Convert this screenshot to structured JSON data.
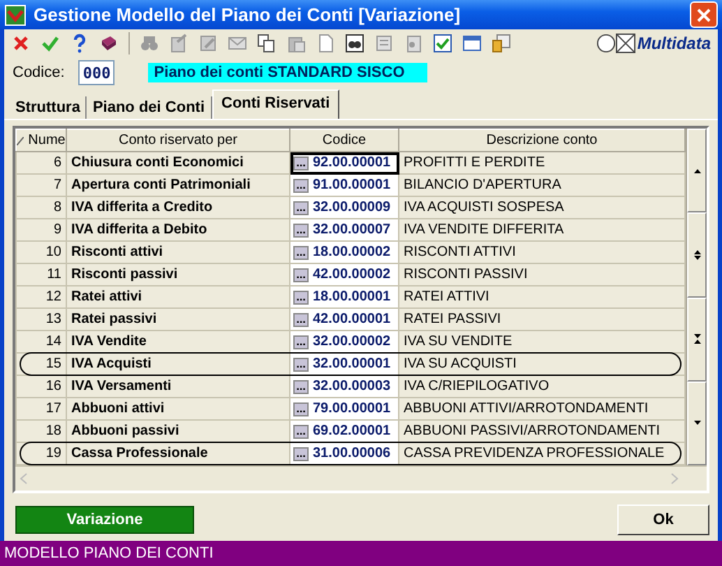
{
  "window": {
    "title": "Gestione Modello del Piano dei Conti [Variazione]"
  },
  "brand": "Multidata",
  "codice": {
    "label": "Codice:",
    "value": "000",
    "description": "Piano dei conti STANDARD SISCO"
  },
  "tabs": [
    {
      "label": "Struttura",
      "selected": false
    },
    {
      "label": "Piano dei Conti",
      "selected": false
    },
    {
      "label": "Conti Riservati",
      "selected": true
    }
  ],
  "table": {
    "columns": [
      "Nume",
      "Conto riservato per",
      "Codice",
      "Descrizione conto"
    ],
    "rows": [
      {
        "num": "6",
        "conto": "Chiusura conti Economici",
        "codice": "92.00.00001",
        "descrizione": "PROFITTI E PERDITE",
        "selected": true
      },
      {
        "num": "7",
        "conto": "Apertura conti Patrimoniali",
        "codice": "91.00.00001",
        "descrizione": "BILANCIO D'APERTURA",
        "selected": false
      },
      {
        "num": "8",
        "conto": "IVA differita a Credito",
        "codice": "32.00.00009",
        "descrizione": "IVA ACQUISTI SOSPESA",
        "selected": false
      },
      {
        "num": "9",
        "conto": "IVA differita a Debito",
        "codice": "32.00.00007",
        "descrizione": "IVA VENDITE DIFFERITA",
        "selected": false
      },
      {
        "num": "10",
        "conto": "Risconti attivi",
        "codice": "18.00.00002",
        "descrizione": "RISCONTI ATTIVI",
        "selected": false
      },
      {
        "num": "11",
        "conto": "Risconti passivi",
        "codice": "42.00.00002",
        "descrizione": "RISCONTI PASSIVI",
        "selected": false
      },
      {
        "num": "12",
        "conto": "Ratei attivi",
        "codice": "18.00.00001",
        "descrizione": "RATEI ATTIVI",
        "selected": false
      },
      {
        "num": "13",
        "conto": "Ratei passivi",
        "codice": "42.00.00001",
        "descrizione": "RATEI PASSIVI",
        "selected": false
      },
      {
        "num": "14",
        "conto": "IVA Vendite",
        "codice": "32.00.00002",
        "descrizione": "IVA SU VENDITE",
        "selected": false,
        "circled": false
      },
      {
        "num": "15",
        "conto": "IVA Acquisti",
        "codice": "32.00.00001",
        "descrizione": "IVA SU ACQUISTI",
        "selected": false,
        "circled": true
      },
      {
        "num": "16",
        "conto": "IVA Versamenti",
        "codice": "32.00.00003",
        "descrizione": "IVA C/RIEPILOGATIVO",
        "selected": false,
        "circled": false
      },
      {
        "num": "17",
        "conto": "Abbuoni attivi",
        "codice": "79.00.00001",
        "descrizione": "ABBUONI ATTIVI/ARROTONDAMENTI",
        "selected": false
      },
      {
        "num": "18",
        "conto": "Abbuoni passivi",
        "codice": "69.02.00001",
        "descrizione": "ABBUONI PASSIVI/ARROTONDAMENTI",
        "selected": false
      },
      {
        "num": "19",
        "conto": "Cassa Professionale",
        "codice": "31.00.00006",
        "descrizione": "CASSA PREVIDENZA PROFESSIONALE",
        "selected": false,
        "circled": true
      }
    ]
  },
  "buttons": [
    {
      "kind": "mode",
      "label": "Variazione"
    },
    {
      "kind": "ok",
      "label": "Ok"
    }
  ],
  "status_bar": "MODELLO PIANO DEI CONTI"
}
